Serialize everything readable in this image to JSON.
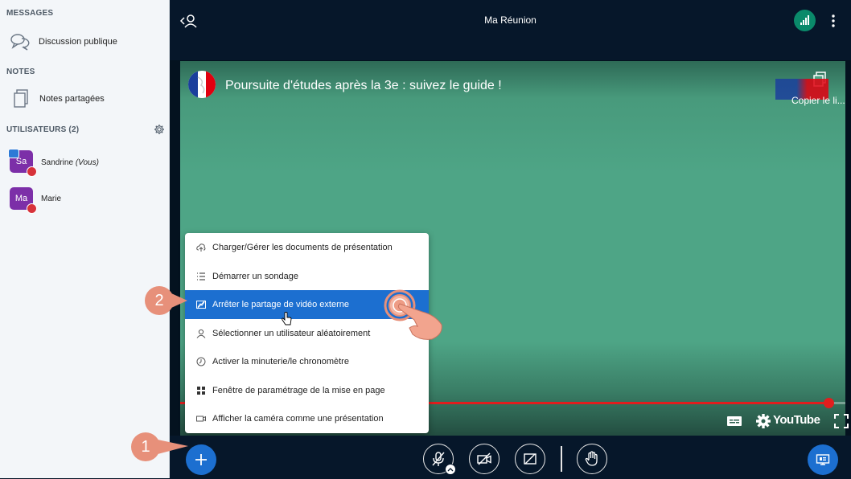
{
  "sidebar": {
    "messages_title": "MESSAGES",
    "public_chat": "Discussion publique",
    "notes_title": "NOTES",
    "shared_notes": "Notes partagées",
    "users_title": "UTILISATEURS (2)",
    "users": [
      {
        "initials": "Sa",
        "name": "Sandrine",
        "suffix": "(Vous)"
      },
      {
        "initials": "Ma",
        "name": "Marie",
        "suffix": ""
      }
    ]
  },
  "header": {
    "title": "Ma Réunion"
  },
  "video": {
    "title": "Poursuite d'études après la 3e : suivez le guide !",
    "copy_label": "Copier le li...",
    "youtube_label": "YouTube",
    "progress": 0.975
  },
  "menu": {
    "items": [
      {
        "label": "Charger/Gérer les documents de présentation",
        "icon": "upload-icon"
      },
      {
        "label": "Démarrer un sondage",
        "icon": "poll-icon"
      },
      {
        "label": "Arrêter le partage de vidéo externe",
        "icon": "external-video-icon",
        "active": true
      },
      {
        "label": "Sélectionner un utilisateur aléatoirement",
        "icon": "user-icon"
      },
      {
        "label": "Activer la minuterie/le chronomètre",
        "icon": "timer-icon"
      },
      {
        "label": "Fenêtre de paramétrage de la mise en page",
        "icon": "layout-icon"
      },
      {
        "label": "Afficher la caméra comme une présentation",
        "icon": "camera-icon"
      }
    ]
  },
  "steps": [
    "1",
    "2"
  ],
  "colors": {
    "accent": "#1c6fd0",
    "navy": "#06172a",
    "step": "#e7907a",
    "avatar": "#7c2fa8"
  }
}
